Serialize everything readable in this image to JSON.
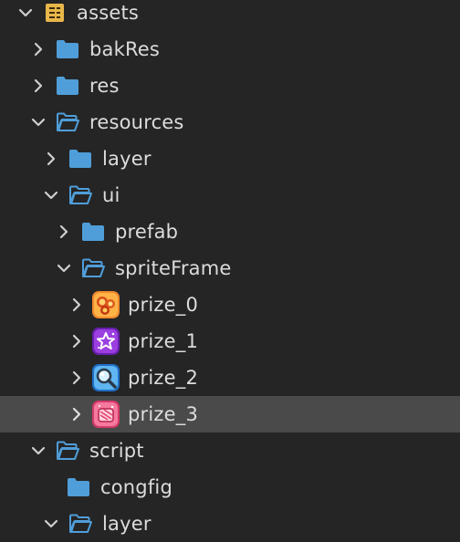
{
  "tree": {
    "colors": {
      "background": "#252526",
      "selected_row": "#4a4a4b",
      "folder_icon": "#4f9ed9",
      "text": "#dcdcdc"
    },
    "items": [
      {
        "label": "assets",
        "expanded": true,
        "icon": "database-icon"
      },
      {
        "label": "bakRes",
        "expanded": false,
        "icon": "folder-icon"
      },
      {
        "label": "res",
        "expanded": false,
        "icon": "folder-icon"
      },
      {
        "label": "resources",
        "expanded": true,
        "icon": "folder-open-icon"
      },
      {
        "label": "layer",
        "expanded": false,
        "icon": "folder-icon"
      },
      {
        "label": "ui",
        "expanded": true,
        "icon": "folder-open-icon"
      },
      {
        "label": "prefab",
        "expanded": false,
        "icon": "folder-icon"
      },
      {
        "label": "spriteFrame",
        "expanded": true,
        "icon": "folder-open-icon"
      },
      {
        "label": "prize_0",
        "expanded": false,
        "icon": "image-thumbnail-icon"
      },
      {
        "label": "prize_1",
        "expanded": false,
        "icon": "image-thumbnail-icon"
      },
      {
        "label": "prize_2",
        "expanded": false,
        "icon": "image-thumbnail-icon"
      },
      {
        "label": "prize_3",
        "expanded": false,
        "icon": "image-thumbnail-icon",
        "selected": true
      },
      {
        "label": "script",
        "expanded": true,
        "icon": "folder-open-icon"
      },
      {
        "label": "congfig",
        "icon": "folder-icon"
      },
      {
        "label": "layer",
        "expanded": true,
        "icon": "folder-open-icon"
      }
    ]
  }
}
